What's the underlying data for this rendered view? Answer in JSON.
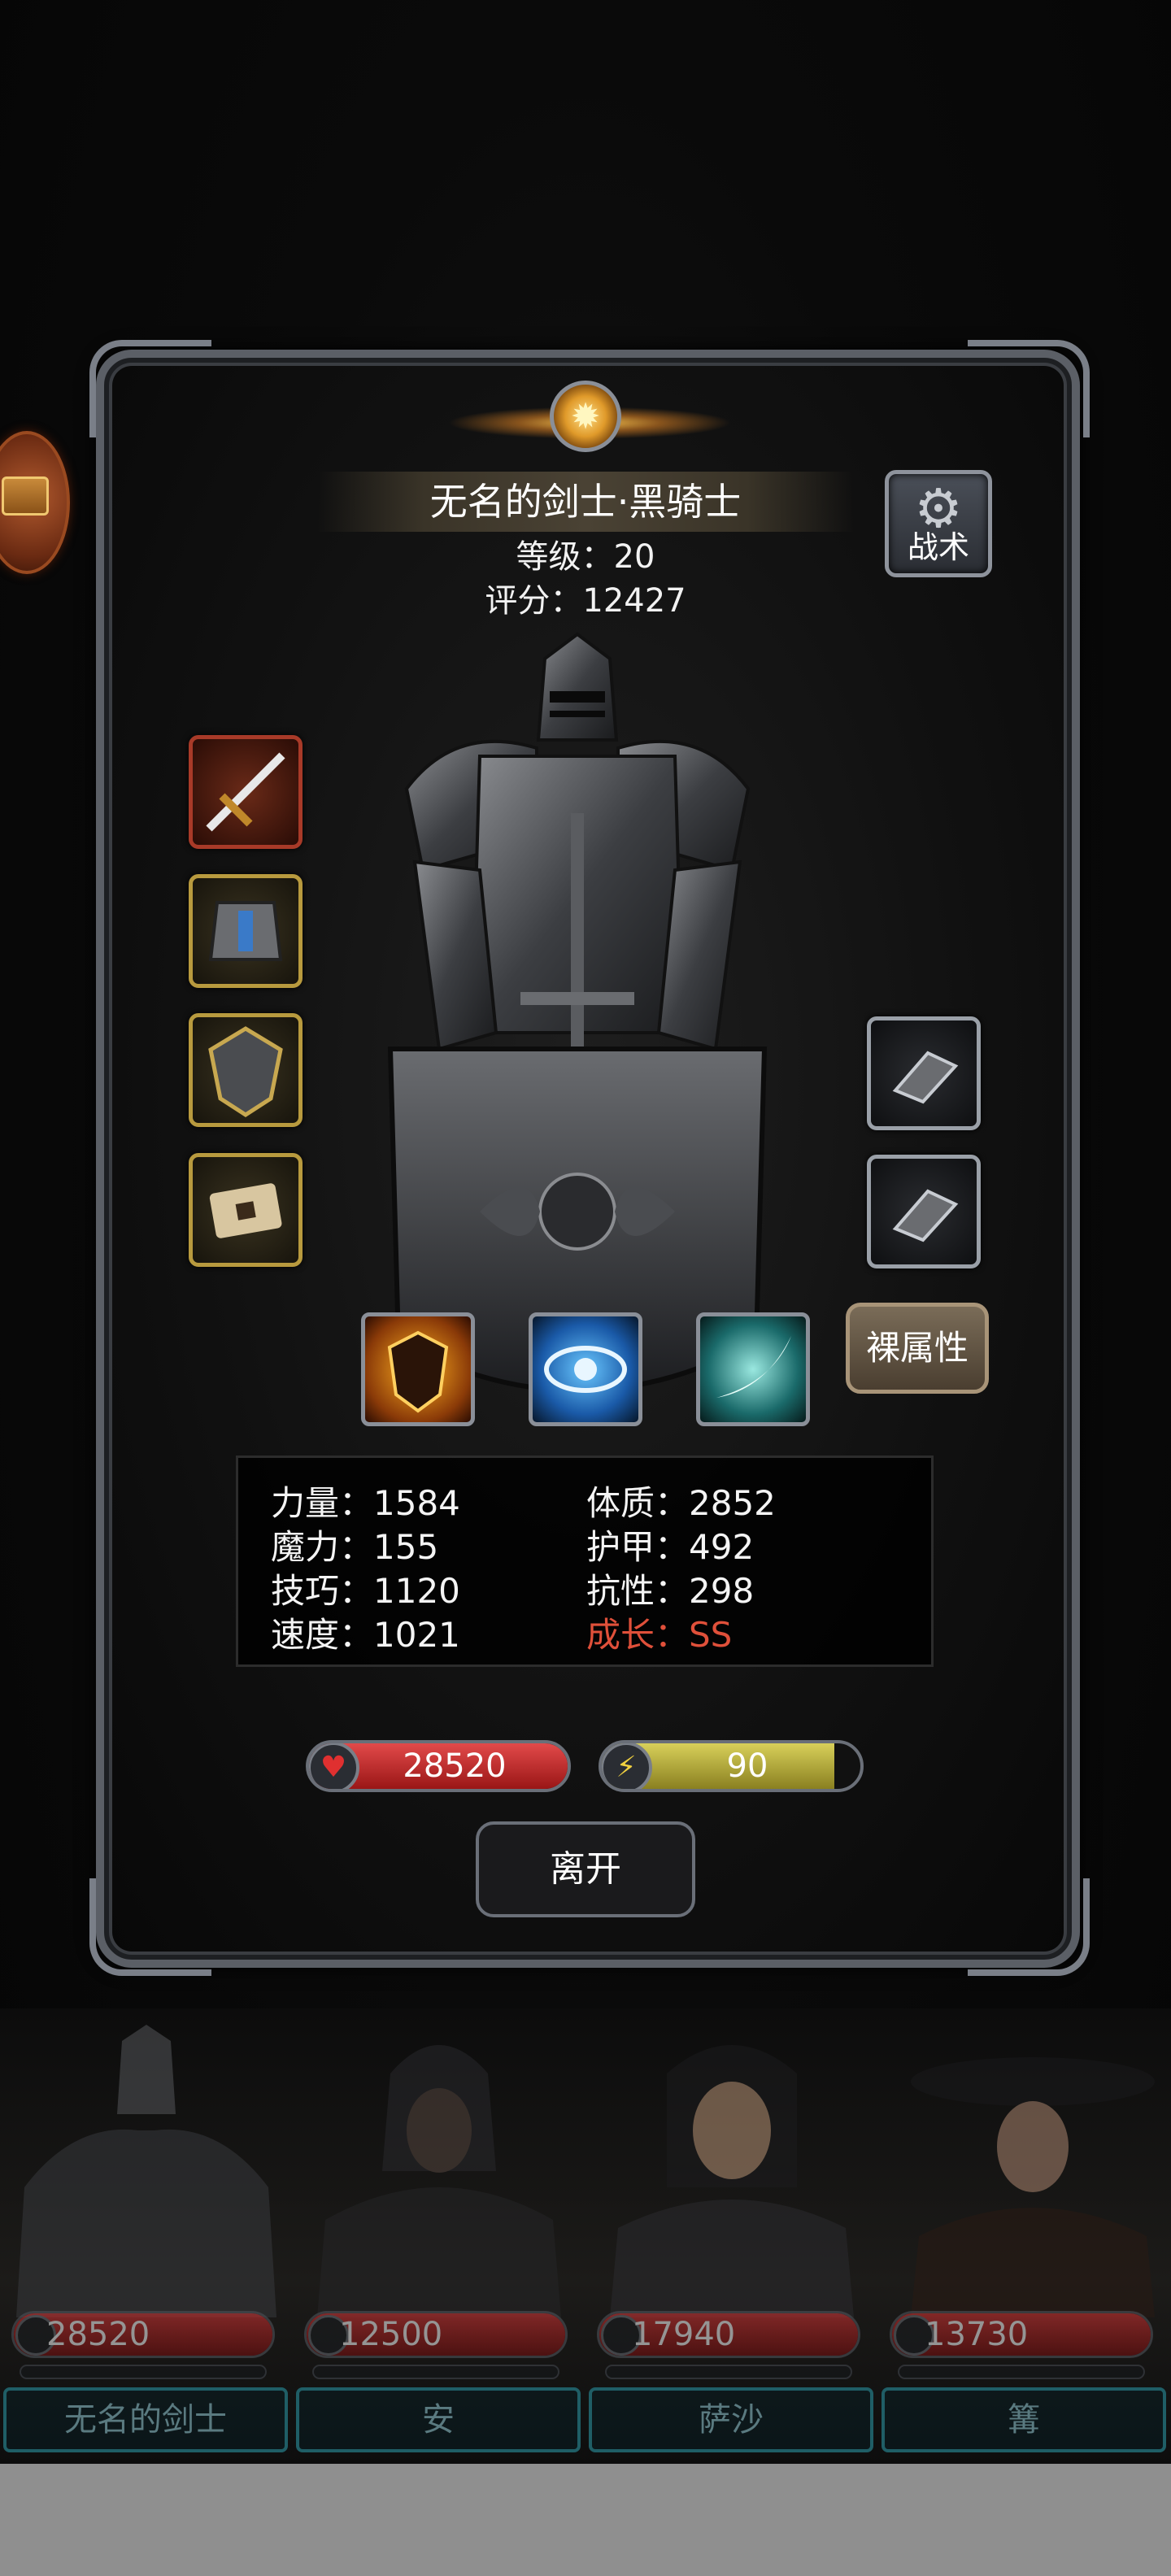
{
  "hero": {
    "title": "无名的剑士·黑骑士",
    "level": "等级：20",
    "score": "评分：12427"
  },
  "buttons": {
    "tactics": "战术",
    "naked_stats": "裸属性",
    "leave": "离开"
  },
  "equipment": {
    "left_slots": [
      "sword-icon",
      "armor-icon",
      "shield-icon",
      "tome-icon"
    ],
    "right_slots": [
      "gauntlet-icon",
      "gauntlet-icon"
    ]
  },
  "skills": [
    "fire-shield-skill-icon",
    "eye-skill-icon",
    "slash-skill-icon"
  ],
  "stats": {
    "strength": "力量：1584",
    "magic": "魔力：155",
    "skill": "技巧：1120",
    "speed": "速度：1021",
    "constitution": "体质：2852",
    "armor": "护甲：492",
    "resistance": "抗性：298",
    "growth_label": "成长：",
    "growth_value": "SS"
  },
  "bars": {
    "hp": "28520",
    "energy": "90",
    "hp_fill_pct": 100,
    "energy_fill_pct": 90
  },
  "roster": [
    {
      "name": "无名的剑士",
      "hp": "28520"
    },
    {
      "name": "安",
      "hp": "12500"
    },
    {
      "name": "萨沙",
      "hp": "17940"
    },
    {
      "name": "篝",
      "hp": "13730"
    }
  ],
  "colors": {
    "growth": "#e0503a",
    "hp": "#c82a2a",
    "energy": "#c8be3a",
    "slot_gold": "#b89a3e",
    "slot_red": "#a83a28"
  }
}
